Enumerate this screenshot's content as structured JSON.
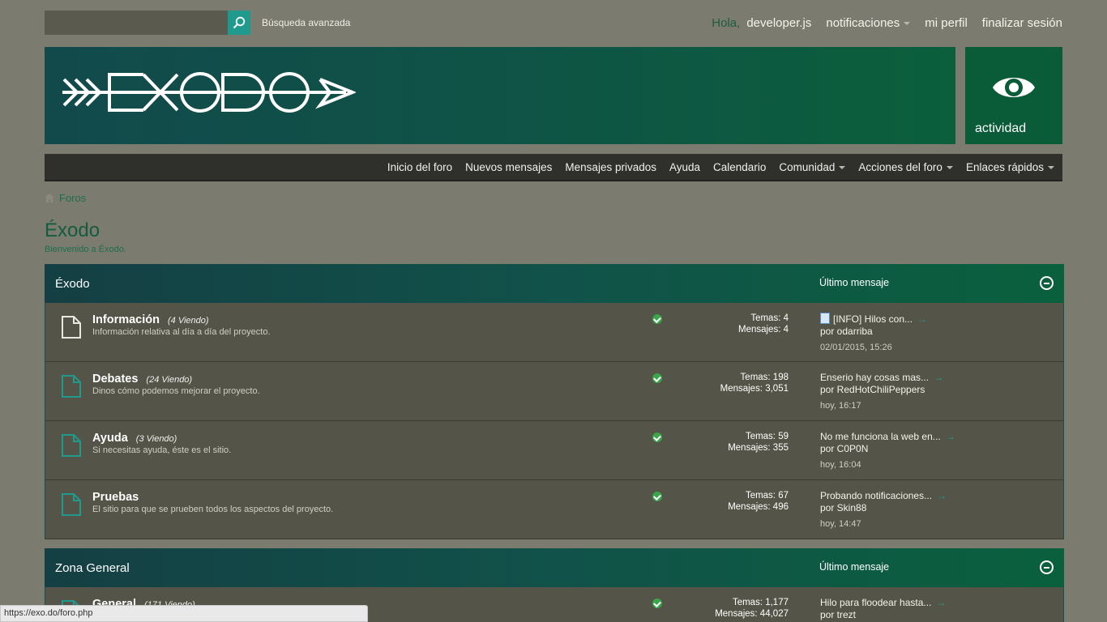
{
  "topbar": {
    "search_placeholder": "",
    "advanced_search": "Búsqueda avanzada",
    "greeting": "Hola,",
    "username": "developer.js",
    "notifications": "notificaciones",
    "profile": "mi perfil",
    "logout": "finalizar sesión"
  },
  "banner": {
    "logo_text": "EXODO",
    "activity_label": "actividad"
  },
  "nav": {
    "items": [
      "Inicio del foro",
      "Nuevos mensajes",
      "Mensajes privados",
      "Ayuda",
      "Calendario",
      "Comunidad",
      "Acciones del foro",
      "Enlaces rápidos"
    ]
  },
  "breadcrumb": {
    "root": "Foros"
  },
  "page": {
    "title": "Éxodo",
    "description": "Bienvenido a Éxodo."
  },
  "categories": [
    {
      "title": "Éxodo",
      "last_header": "Último mensaje",
      "forums": [
        {
          "name": "Información",
          "viewing": "(4 Viendo)",
          "desc": "Información relativa al día a día del proyecto.",
          "temas": "Temas: 4",
          "mensajes": "Mensajes: 4",
          "last_title": "[INFO] Hilos con...",
          "last_by": "por odarriba",
          "last_date": "02/01/2015, 15:26"
        },
        {
          "name": "Debates",
          "viewing": "(24 Viendo)",
          "desc": "Dinos cómo podemos mejorar el proyecto.",
          "temas": "Temas: 198",
          "mensajes": "Mensajes: 3,051",
          "last_title": "Enserio hay cosas mas...",
          "last_by": "por RedHotChiliPeppers",
          "last_date": "hoy, 16:17"
        },
        {
          "name": "Ayuda",
          "viewing": "(3 Viendo)",
          "desc": "Si necesitas ayuda, éste es el sitio.",
          "temas": "Temas: 59",
          "mensajes": "Mensajes: 355",
          "last_title": "No me funciona la web en...",
          "last_by": "por C0P0N",
          "last_date": "hoy, 16:04"
        },
        {
          "name": "Pruebas",
          "viewing": "",
          "desc": "El sitio para que se prueben todos los aspectos del proyecto.",
          "temas": "Temas: 67",
          "mensajes": "Mensajes: 496",
          "last_title": "Probando notificaciones...",
          "last_by": "por Skin88",
          "last_date": "hoy, 14:47"
        }
      ]
    },
    {
      "title": "Zona General",
      "last_header": "Último mensaje",
      "forums": [
        {
          "name": "General",
          "viewing": "(171 Viendo)",
          "desc": "",
          "temas": "Temas: 1,177",
          "mensajes": "Mensajes: 44,027",
          "last_title": "Hilo para floodear hasta...",
          "last_by": "por trezt",
          "last_date": ""
        }
      ]
    }
  ],
  "statusbar": {
    "url": "https://exo.do/foro.php"
  },
  "colors": {
    "accent": "#1f9a8c",
    "header_dark": "#124a4c",
    "header_green": "#0a603d",
    "background": "#7b7b6f",
    "row": "#545448"
  }
}
